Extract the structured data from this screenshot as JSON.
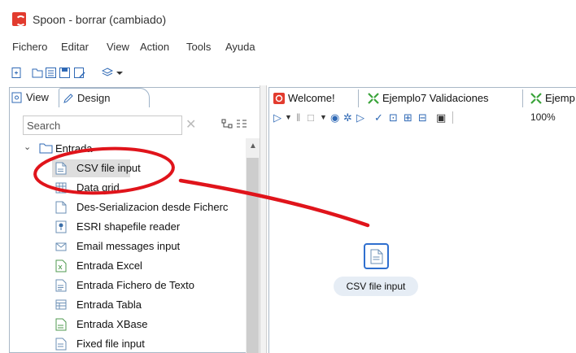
{
  "window": {
    "title": "Spoon - borrar (cambiado)"
  },
  "menu": [
    "Fichero",
    "Editar",
    "View",
    "Action",
    "Tools",
    "Ayuda"
  ],
  "left_panel": {
    "tabs": [
      {
        "label": "View",
        "icon": "view-icon"
      },
      {
        "label": "Design",
        "icon": "pencil-icon"
      }
    ],
    "search": {
      "placeholder": "Search",
      "value": ""
    },
    "tree": {
      "folder": "Entrada",
      "items": [
        {
          "label": "CSV file input",
          "icon": "csv-file-icon",
          "selected": true
        },
        {
          "label": "Data grid",
          "icon": "grid-icon"
        },
        {
          "label": "Des-Serializacion desde Ficherc",
          "icon": "file-icon"
        },
        {
          "label": "ESRI shapefile reader",
          "icon": "map-pin-icon"
        },
        {
          "label": "Email messages input",
          "icon": "email-icon"
        },
        {
          "label": "Entrada Excel",
          "icon": "excel-icon"
        },
        {
          "label": "Entrada Fichero de Texto",
          "icon": "text-file-icon"
        },
        {
          "label": "Entrada Tabla",
          "icon": "table-icon"
        },
        {
          "label": "Entrada XBase",
          "icon": "xbase-icon"
        },
        {
          "label": "Fixed file input",
          "icon": "fixed-file-icon"
        }
      ]
    }
  },
  "editor": {
    "tabs": [
      {
        "label": "Welcome!",
        "icon": "spoon-icon"
      },
      {
        "label": "Ejemplo7 Validaciones",
        "icon": "transformation-icon"
      },
      {
        "label": "Ejemp",
        "icon": "transformation-icon"
      }
    ],
    "zoom": "100%",
    "canvas_step": {
      "label": "CSV file input",
      "icon": "csv-file-icon"
    }
  },
  "colors": {
    "accent": "#2f6fcf",
    "annotation": "#e0141b",
    "selection": "#dedede"
  }
}
